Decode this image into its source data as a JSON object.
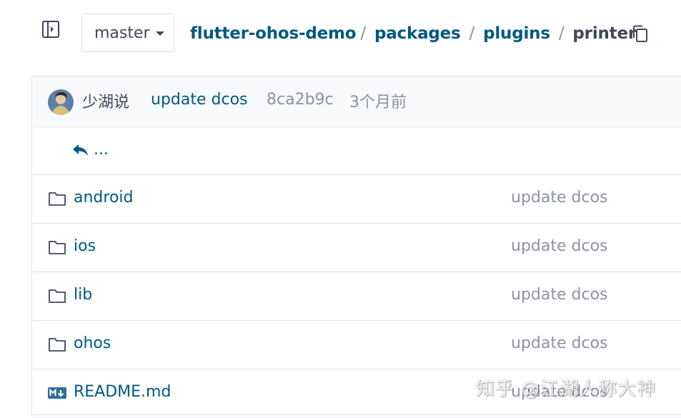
{
  "branch": {
    "name": "master"
  },
  "breadcrumb": {
    "items": [
      "flutter-ohos-demo",
      "packages",
      "plugins"
    ],
    "separator": "/",
    "current": "printer"
  },
  "commit": {
    "author": "少湖说",
    "message": "update dcos",
    "hash": "8ca2b9c",
    "time": "3个月前"
  },
  "back": {
    "label": "..."
  },
  "files": [
    {
      "name": "android",
      "type": "folder",
      "commit": "update dcos"
    },
    {
      "name": "ios",
      "type": "folder",
      "commit": "update dcos"
    },
    {
      "name": "lib",
      "type": "folder",
      "commit": "update dcos"
    },
    {
      "name": "ohos",
      "type": "folder",
      "commit": "update dcos"
    },
    {
      "name": "README.md",
      "type": "markdown",
      "commit": "update dcos"
    }
  ],
  "watermark": "知乎 @江湖人称大神",
  "colors": {
    "link": "#005980",
    "muted": "#8c92a4",
    "text": "#40485b",
    "border": "#e3e6ed"
  }
}
